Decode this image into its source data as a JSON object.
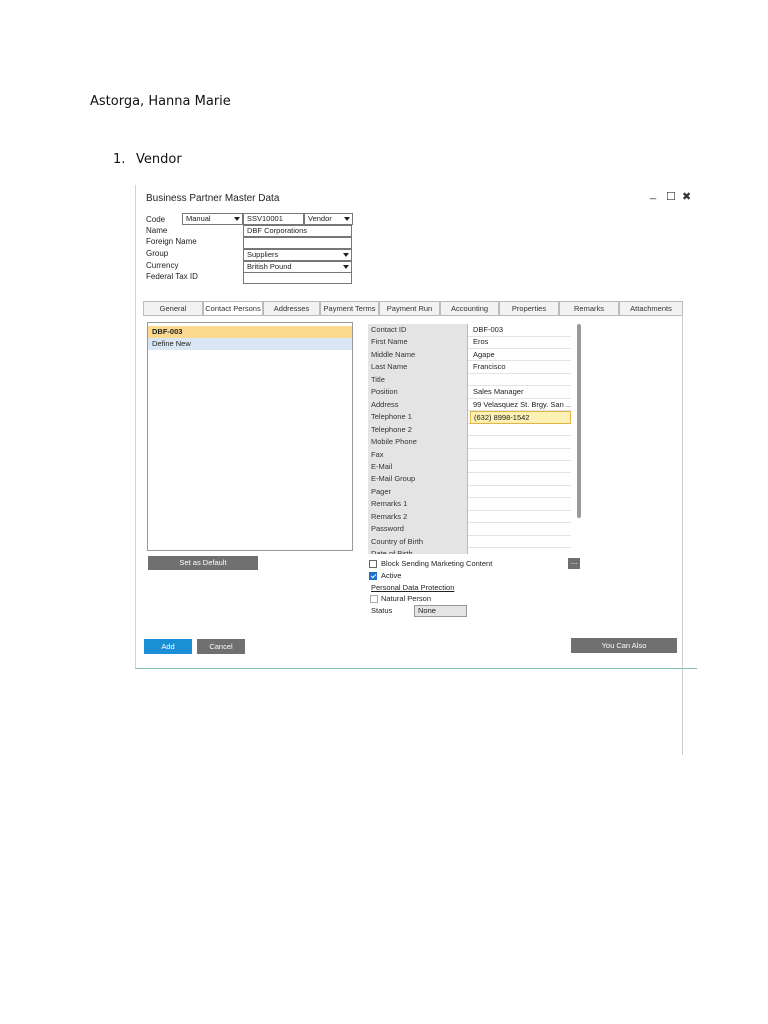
{
  "document": {
    "author": "Astorga, Hanna Marie",
    "item_number": "1.",
    "item_label": "Vendor"
  },
  "window": {
    "title": "Business Partner Master Data",
    "controls": {
      "minimize": "_",
      "maximize": "☐",
      "close": "✖"
    }
  },
  "header": {
    "code_label": "Code",
    "code_mode": "Manual",
    "code_value": "SSV10001",
    "bp_type": "Vendor",
    "name_label": "Name",
    "name_value": "DBF Corporations",
    "foreign_name_label": "Foreign Name",
    "foreign_name_value": "",
    "group_label": "Group",
    "group_value": "Suppliers",
    "currency_label": "Currency",
    "currency_value": "British Pound",
    "federal_tax_label": "Federal Tax ID",
    "federal_tax_value": ""
  },
  "tabs": [
    {
      "label": "General"
    },
    {
      "label": "Contact Persons"
    },
    {
      "label": "Addresses"
    },
    {
      "label": "Payment Terms"
    },
    {
      "label": "Payment Run"
    },
    {
      "label": "Accounting"
    },
    {
      "label": "Properties"
    },
    {
      "label": "Remarks"
    },
    {
      "label": "Attachments"
    }
  ],
  "contact_list": [
    {
      "label": "DBF-003"
    },
    {
      "label": "Define New"
    }
  ],
  "set_default_label": "Set as Default",
  "details": [
    {
      "label": "Contact ID",
      "value": "DBF-003"
    },
    {
      "label": "First Name",
      "value": "Eros"
    },
    {
      "label": "Middle Name",
      "value": "Agape"
    },
    {
      "label": "Last Name",
      "value": "Francisco"
    },
    {
      "label": "Title",
      "value": ""
    },
    {
      "label": "Position",
      "value": "Sales Manager"
    },
    {
      "label": "Address",
      "value": "99 Velasquez St. Brgy. San ..."
    },
    {
      "label": "Telephone 1",
      "value": "(632) 8998-1542"
    },
    {
      "label": "Telephone 2",
      "value": ""
    },
    {
      "label": "Mobile Phone",
      "value": ""
    },
    {
      "label": "Fax",
      "value": ""
    },
    {
      "label": "E-Mail",
      "value": ""
    },
    {
      "label": "E-Mail Group",
      "value": ""
    },
    {
      "label": "Pager",
      "value": ""
    },
    {
      "label": "Remarks 1",
      "value": ""
    },
    {
      "label": "Remarks 2",
      "value": ""
    },
    {
      "label": "Password",
      "value": ""
    },
    {
      "label": "Country of Birth",
      "value": ""
    },
    {
      "label": "Date of Birth",
      "value": ""
    }
  ],
  "options": {
    "block_marketing": "Block Sending Marketing Content",
    "active": "Active",
    "personal_data_protection": "Personal Data Protection",
    "natural_person": "Natural Person",
    "status_label": "Status",
    "status_value": "None",
    "more_button": "..."
  },
  "footer": {
    "add": "Add",
    "cancel": "Cancel",
    "you_can_also": "You Can Also"
  },
  "colors": {
    "accent_blue": "#1a8fd6",
    "selected_row": "#fbd98e",
    "highlight_field": "#fdf2b3"
  }
}
